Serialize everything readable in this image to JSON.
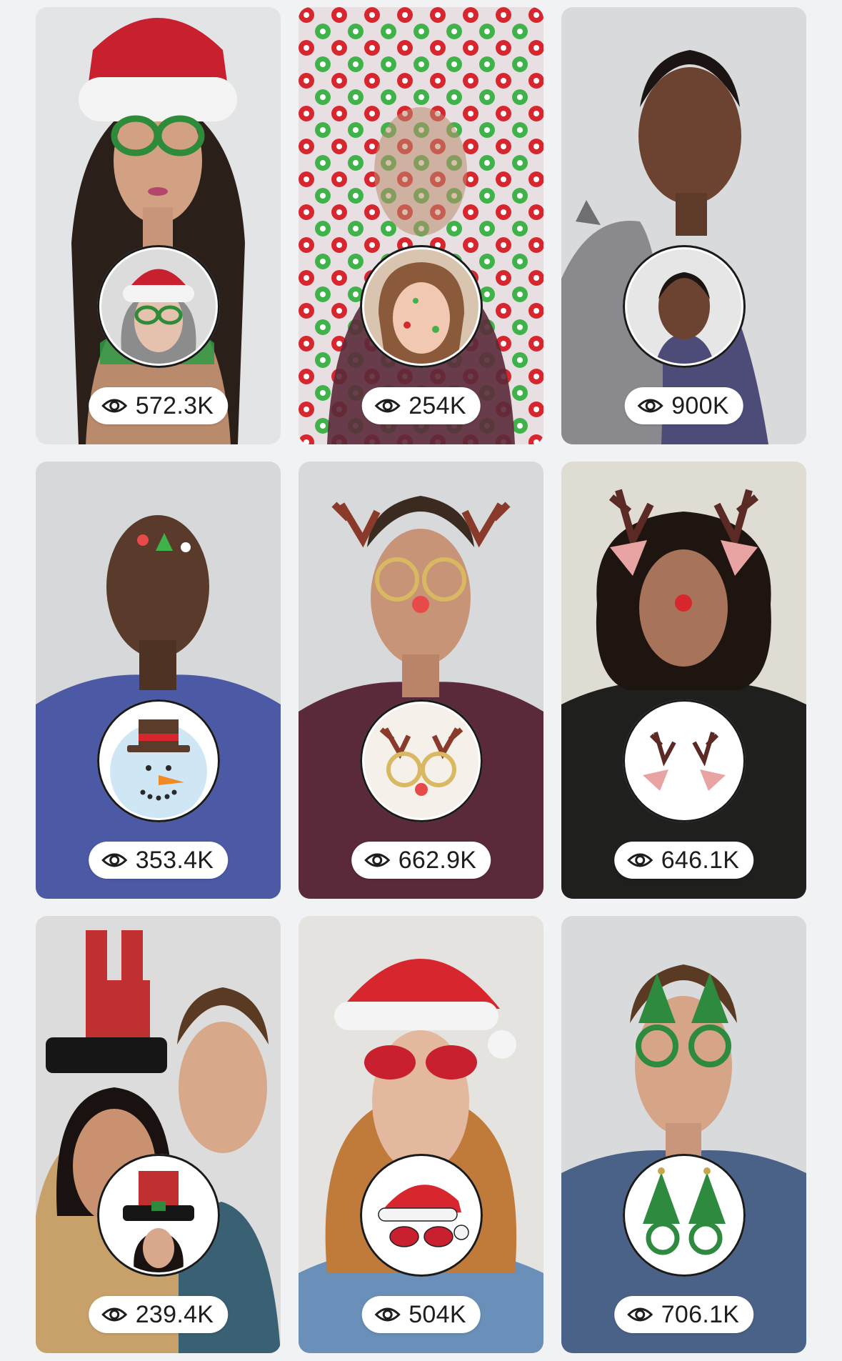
{
  "icons": {
    "views": "eye-icon"
  },
  "lenses": [
    {
      "views": "572.3K",
      "subject": "Santa hat and Christmas glasses"
    },
    {
      "views": "254K",
      "subject": "Peppermint candy pattern"
    },
    {
      "views": "900K",
      "subject": "Cat companion"
    },
    {
      "views": "353.4K",
      "subject": "Snowman stickers"
    },
    {
      "views": "662.9K",
      "subject": "Reindeer glasses"
    },
    {
      "views": "646.1K",
      "subject": "Reindeer antlers"
    },
    {
      "views": "239.4K",
      "subject": "Chimney top hat"
    },
    {
      "views": "504K",
      "subject": "Santa hat and sunglasses"
    },
    {
      "views": "706.1K",
      "subject": "Christmas tree glasses"
    }
  ],
  "colors": {
    "page_background": "#f1f2f4",
    "badge_background": "#ffffff",
    "badge_text": "#1d1d1f"
  }
}
